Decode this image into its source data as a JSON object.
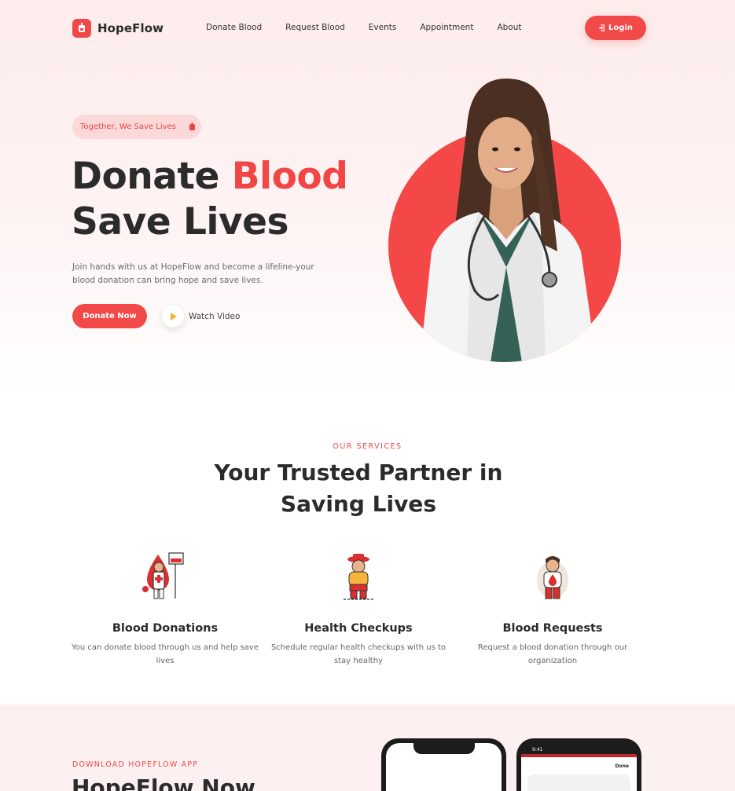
{
  "brand": {
    "name": "HopeFlow",
    "accent": "#f24949"
  },
  "nav": {
    "items": [
      "Donate Blood",
      "Request Blood",
      "Events",
      "Appointment",
      "About"
    ],
    "login_label": "Login"
  },
  "hero": {
    "tagline": "Together, We Save Lives",
    "title_line1": "Donate",
    "title_highlight": "Blood",
    "title_line2": "Save Lives",
    "description": "Join hands with us at HopeFlow and become a lifeline-your blood donation can bring hope and save lives.",
    "donate_label": "Donate Now",
    "watch_label": "Watch Video"
  },
  "services": {
    "eyebrow": "OUR SERVICES",
    "title_line1": "Your Trusted Partner in",
    "title_line2": "Saving Lives",
    "items": [
      {
        "title": "Blood Donations",
        "description": "You can donate blood through us and help save lives",
        "icon": "blood-donor-icon"
      },
      {
        "title": "Health Checkups",
        "description": "Schedule regular health checkups with us to stay healthy",
        "icon": "health-checkup-icon"
      },
      {
        "title": "Blood Requests",
        "description": "Request a blood donation through our organization",
        "icon": "blood-request-icon"
      }
    ]
  },
  "app": {
    "eyebrow": "DOWNLOAD HOPEFLOW APP",
    "title": "HopeFlow Now",
    "phone_time": "9:41",
    "phone_done": "Done"
  }
}
